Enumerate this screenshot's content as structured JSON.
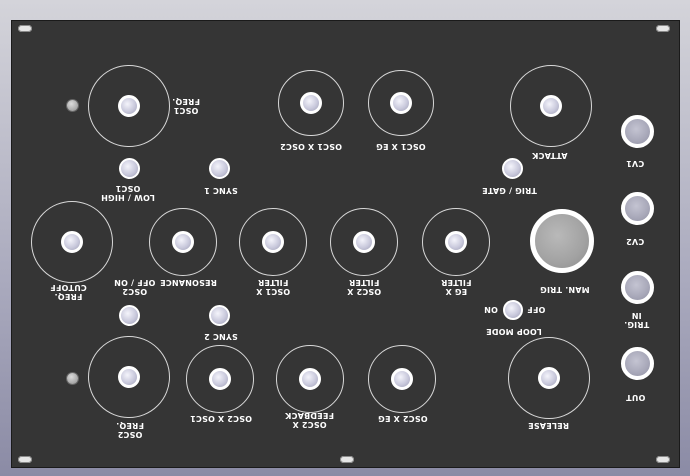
{
  "labels": {
    "osc1_freq": [
      "OSC1",
      "FREQ."
    ],
    "osc1_x_osc2": [
      "OSC1 X OSC2"
    ],
    "osc1_x_eg": [
      "OSC1 X EG"
    ],
    "attack": [
      "ATTACK"
    ],
    "cv1": [
      "CV1"
    ],
    "low_high": [
      "LOW / HIGH",
      "OSC1"
    ],
    "sync1": [
      "SYNC 1"
    ],
    "trig_gate": [
      "TRIG / GATE"
    ],
    "cv2": [
      "CV2"
    ],
    "freq_cutoff": [
      "FREQ.",
      "CUTOFF"
    ],
    "osc2_off_on": [
      "OSC2",
      "OFF / ON"
    ],
    "resonance": [
      "RESONANCE"
    ],
    "osc1_x_filter": [
      "OSC1 X",
      "FILTER"
    ],
    "osc2_x_filter": [
      "OSC2 X",
      "FILTER"
    ],
    "eg_x_filter": [
      "EG X",
      "FILTER"
    ],
    "man_trig": [
      "MAN. TRIG"
    ],
    "trig_in": [
      "TRIG.",
      "IN"
    ],
    "sync2": [
      "SYNC 2"
    ],
    "on": [
      "ON"
    ],
    "off": [
      "OFF"
    ],
    "loop_mode": [
      "LOOP MODE"
    ],
    "osc2_freq": [
      "OSC2",
      "FREQ."
    ],
    "osc2_x_osc1": [
      "OSC2 X OSC1"
    ],
    "osc2_x_feedback": [
      "OSC2 X",
      "FEEDBACK"
    ],
    "osc2_x_eg": [
      "OSC2 X EG"
    ],
    "release": [
      "RELEASE"
    ],
    "out": [
      "OUT"
    ]
  },
  "colors": {
    "panel": "#353535",
    "knob_cap": "#c9c9dc",
    "outline": "#ffffff"
  },
  "icons": {
    "screw": "screw-icon",
    "led": "led-icon"
  }
}
